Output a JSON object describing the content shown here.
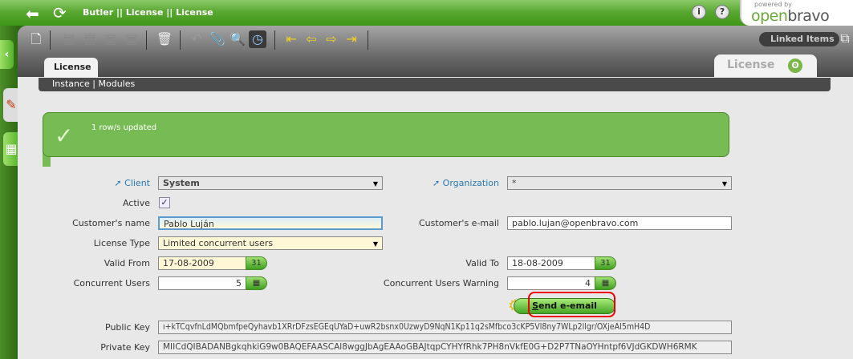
{
  "header": {
    "title": "Butler || License  ||  License",
    "info": "i",
    "help": "?",
    "logo_powered": "powered by",
    "logo_open": "open",
    "logo_bravo": "bravo"
  },
  "toolbar": {
    "linked_items": "Linked Items"
  },
  "tabs": {
    "main": "License",
    "right": "License"
  },
  "subnav": {
    "items": [
      "Instance",
      "Modules"
    ]
  },
  "message": {
    "text": "1 row/s updated"
  },
  "form": {
    "client_label": "Client",
    "client_value": "System",
    "org_label": "Organization",
    "org_value": "*",
    "active_label": "Active",
    "active_checked": true,
    "name_label": "Customer's name",
    "name_value": "Pablo Luján",
    "email_label": "Customer's e-mail",
    "email_value": "pablo.lujan@openbravo.com",
    "type_label": "License Type",
    "type_value": "Limited concurrent users",
    "from_label": "Valid From",
    "from_value": "17-08-2009",
    "to_label": "Valid To",
    "to_value": "18-08-2009",
    "users_label": "Concurrent Users",
    "users_value": "5",
    "warn_label": "Concurrent Users Warning",
    "warn_value": "4",
    "send_label_first": "S",
    "send_label_rest": "end e-email",
    "pub_label": "Public Key",
    "pub_value": "ı+kTCqvfnLdMQbmfpeQyhavb1XRrDFzsEGEqUYaD+uwR2bsnx0UzwyD9NqN1Kp11q2sMfbco3cKP5Vl8ny7WLp2llgr/OXjeAI5mH4D",
    "priv_label": "Private Key",
    "priv_value": "MIICdQIBADANBgkqhkiG9w0BAQEFAASCAl8wggJbAgEAAoGBAJtqpCYHYfRhk7PH8nVkfE0G+D2P7TNaOYHntpf6VJdGKDWH6RMK",
    "calendar_day": "31"
  }
}
